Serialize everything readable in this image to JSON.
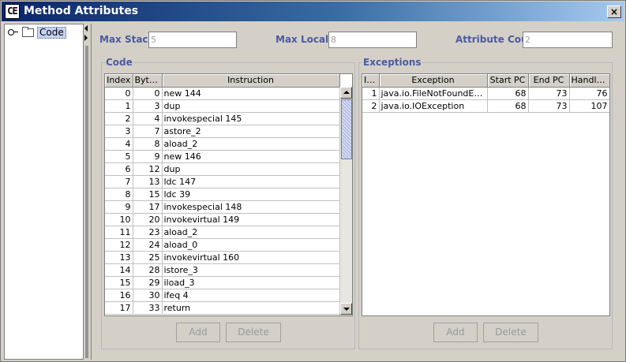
{
  "window": {
    "app_icon_text": "CE",
    "title": "Method Attributes",
    "close_label": "×"
  },
  "tree": {
    "node_label": "Code"
  },
  "fields": {
    "max_stack": {
      "label": "Max Stack",
      "value": "5"
    },
    "max_locals": {
      "label": "Max Locals",
      "value": "8"
    },
    "attribute_count": {
      "label": "Attribute Count",
      "value": "2"
    }
  },
  "code_panel": {
    "title": "Code",
    "columns": [
      "Index",
      "Byte ...",
      "Instruction"
    ],
    "rows": [
      [
        "0",
        "0",
        "new 144"
      ],
      [
        "1",
        "3",
        "dup"
      ],
      [
        "2",
        "4",
        "invokespecial 145"
      ],
      [
        "3",
        "7",
        "astore_2"
      ],
      [
        "4",
        "8",
        "aload_2"
      ],
      [
        "5",
        "9",
        "new 146"
      ],
      [
        "6",
        "12",
        "dup"
      ],
      [
        "7",
        "13",
        "ldc 147"
      ],
      [
        "8",
        "15",
        "ldc 39"
      ],
      [
        "9",
        "17",
        "invokespecial 148"
      ],
      [
        "10",
        "20",
        "invokevirtual 149"
      ],
      [
        "11",
        "23",
        "aload_2"
      ],
      [
        "12",
        "24",
        "aload_0"
      ],
      [
        "13",
        "25",
        "invokevirtual 160"
      ],
      [
        "14",
        "28",
        "istore_3"
      ],
      [
        "15",
        "29",
        "iload_3"
      ],
      [
        "16",
        "30",
        "ifeq 4"
      ],
      [
        "17",
        "33",
        "return"
      ]
    ],
    "add_label": "Add",
    "delete_label": "Delete"
  },
  "exceptions_panel": {
    "title": "Exceptions",
    "columns": [
      "In...",
      "Exception",
      "Start PC",
      "End PC",
      "Handle..."
    ],
    "rows": [
      [
        "1",
        "java.io.FileNotFoundEx...",
        "68",
        "73",
        "76"
      ],
      [
        "2",
        "java.io.IOException",
        "68",
        "73",
        "107"
      ]
    ],
    "add_label": "Add",
    "delete_label": "Delete"
  }
}
